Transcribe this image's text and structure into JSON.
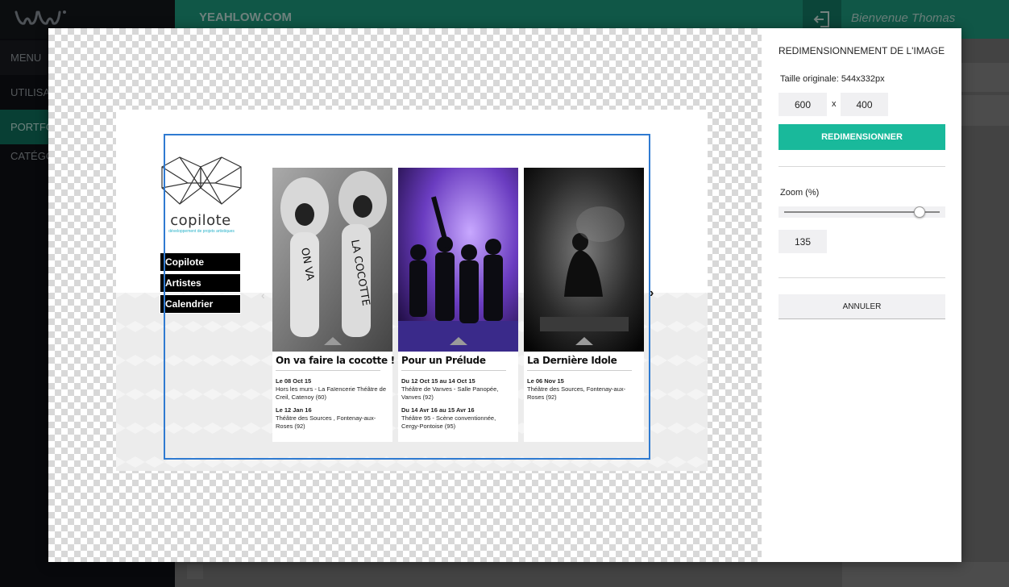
{
  "sidebar": {
    "items": [
      {
        "label": "MENU"
      },
      {
        "label": "UTILISATEURS"
      },
      {
        "label": "PORTFOLIO"
      },
      {
        "label": "CATÉGORIES"
      }
    ]
  },
  "topbar": {
    "site_name": "YEAHLOW.COM",
    "welcome": "Bienvenue Thomas",
    "logout_icon": "logout-icon"
  },
  "preview": {
    "brand_name": "copilote",
    "brand_tagline": "développement de projets artistiques",
    "nav": [
      "Copilote",
      "Artistes",
      "Calendrier"
    ],
    "cards": [
      {
        "title": "On va faire la cocotte !",
        "events": [
          {
            "date": "Le 08 Oct 15",
            "place": "Hors les murs - La Faïencerie Théâtre de Creil, Catenoy (60)"
          },
          {
            "date": "Le 12 Jan 16",
            "place": "Théâtre des Sources , Fontenay-aux-Roses (92)"
          }
        ]
      },
      {
        "title": "Pour un Prélude",
        "events": [
          {
            "date": "Du 12 Oct 15 au 14 Oct 15",
            "place": "Théâtre de Vanves - Salle Panopée, Vanves (92)"
          },
          {
            "date": "Du 14 Avr 16 au 15 Avr 16",
            "place": "Théâtre 95 - Scène conventionnée, Cergy-Pontoise (95)"
          }
        ]
      },
      {
        "title": "La Dernière Idole",
        "events": [
          {
            "date": "Le 06 Nov 15",
            "place": "Théâtre des Sources, Fontenay-aux-Roses (92)"
          }
        ]
      }
    ],
    "arrow_left": "‹",
    "arrow_right": "›"
  },
  "panel": {
    "title": "REDIMENSIONNEMENT DE L'IMAGE",
    "original_size": "Taille originale: 544x332px",
    "width": "600",
    "times": "x",
    "height": "400",
    "resize_label": "REDIMENSIONNER",
    "zoom_label": "Zoom (%)",
    "zoom_value": "135",
    "zoom_fraction": 0.87,
    "cancel_label": "ANNULER"
  },
  "colors": {
    "accent": "#19b99b",
    "topbar": "#1e9e82",
    "sidebar": "#101216",
    "crop_border": "#2f7ad1"
  }
}
